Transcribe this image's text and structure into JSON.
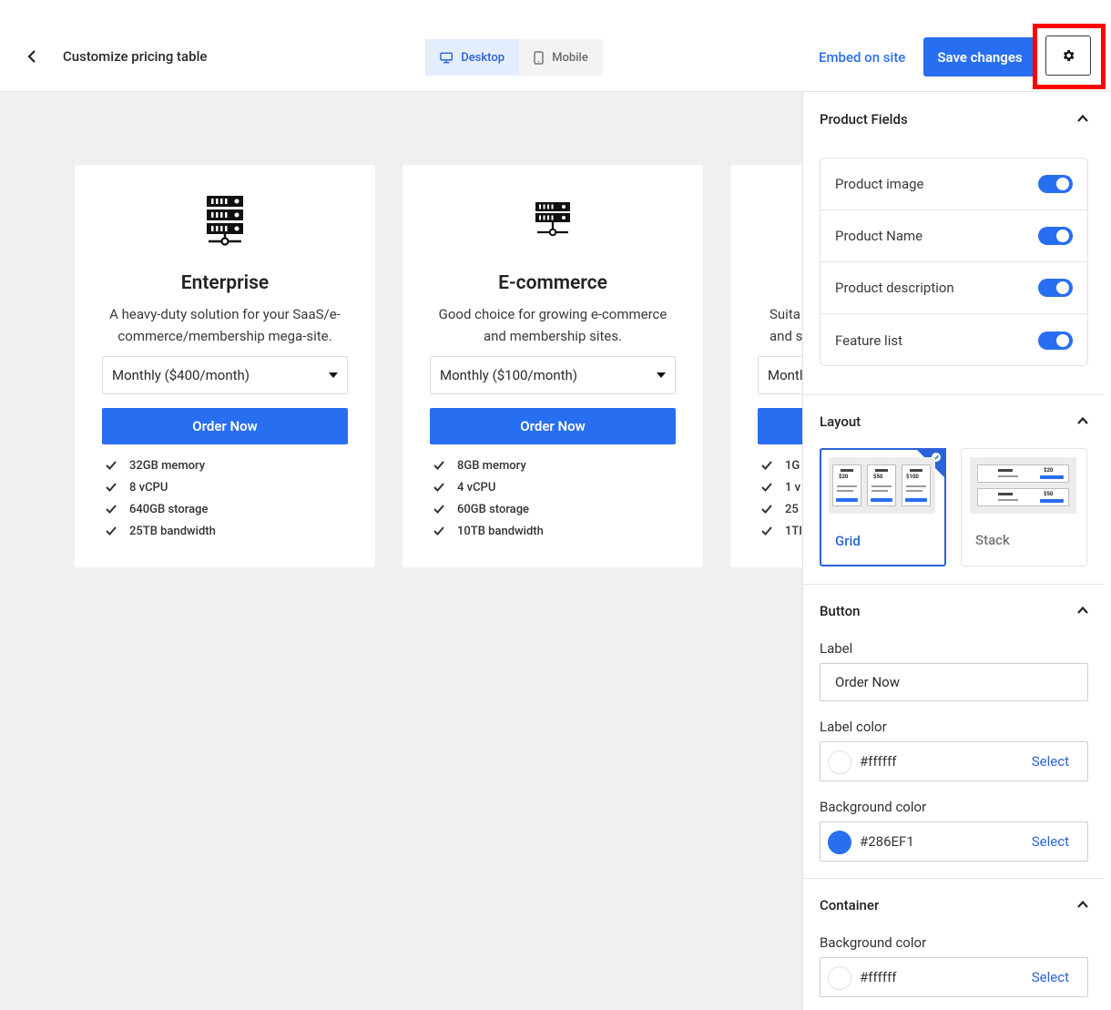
{
  "header": {
    "title": "Customize pricing table",
    "device_desktop": "Desktop",
    "device_mobile": "Mobile",
    "embed_label": "Embed on site",
    "save_label": "Save changes"
  },
  "cards": [
    {
      "name": "Enterprise",
      "description": "A heavy-duty solution for your SaaS/e-commerce/membership mega-site.",
      "plan": "Monthly ($400/month)",
      "button": "Order Now",
      "features": [
        "32GB memory",
        "8 vCPU",
        "640GB storage",
        "25TB bandwidth"
      ]
    },
    {
      "name": "E-commerce",
      "description": "Good choice for growing e-commerce and membership sites.",
      "plan": "Monthly ($100/month)",
      "button": "Order Now",
      "features": [
        "8GB memory",
        "4 vCPU",
        "60GB storage",
        "10TB bandwidth"
      ]
    },
    {
      "name": "",
      "description_line1": "Suita",
      "description_line2": "and sr",
      "plan": "Montl",
      "features": [
        "1G",
        "1 v",
        "25",
        "1TI"
      ]
    }
  ],
  "panel": {
    "product_fields": {
      "title": "Product Fields",
      "fields": [
        {
          "label": "Product image",
          "enabled": true
        },
        {
          "label": "Product Name",
          "enabled": true
        },
        {
          "label": "Product description",
          "enabled": true
        },
        {
          "label": "Feature list",
          "enabled": true
        }
      ]
    },
    "layout": {
      "title": "Layout",
      "options": [
        "Grid",
        "Stack"
      ],
      "selected": "Grid",
      "grid_prices": [
        "$20",
        "$50",
        "$100"
      ],
      "stack_prices": [
        "$20",
        "$50"
      ]
    },
    "button": {
      "title": "Button",
      "label_caption": "Label",
      "label_value": "Order Now",
      "label_color_caption": "Label color",
      "label_color": "#ffffff",
      "bg_color_caption": "Background color",
      "bg_color": "#286EF1",
      "select": "Select"
    },
    "container": {
      "title": "Container",
      "bg_color_caption": "Background color",
      "bg_color": "#ffffff",
      "select": "Select"
    }
  },
  "colors": {
    "accent": "#286EF1",
    "highlight": "#FF0000",
    "canvas": "#F0F0F0"
  }
}
